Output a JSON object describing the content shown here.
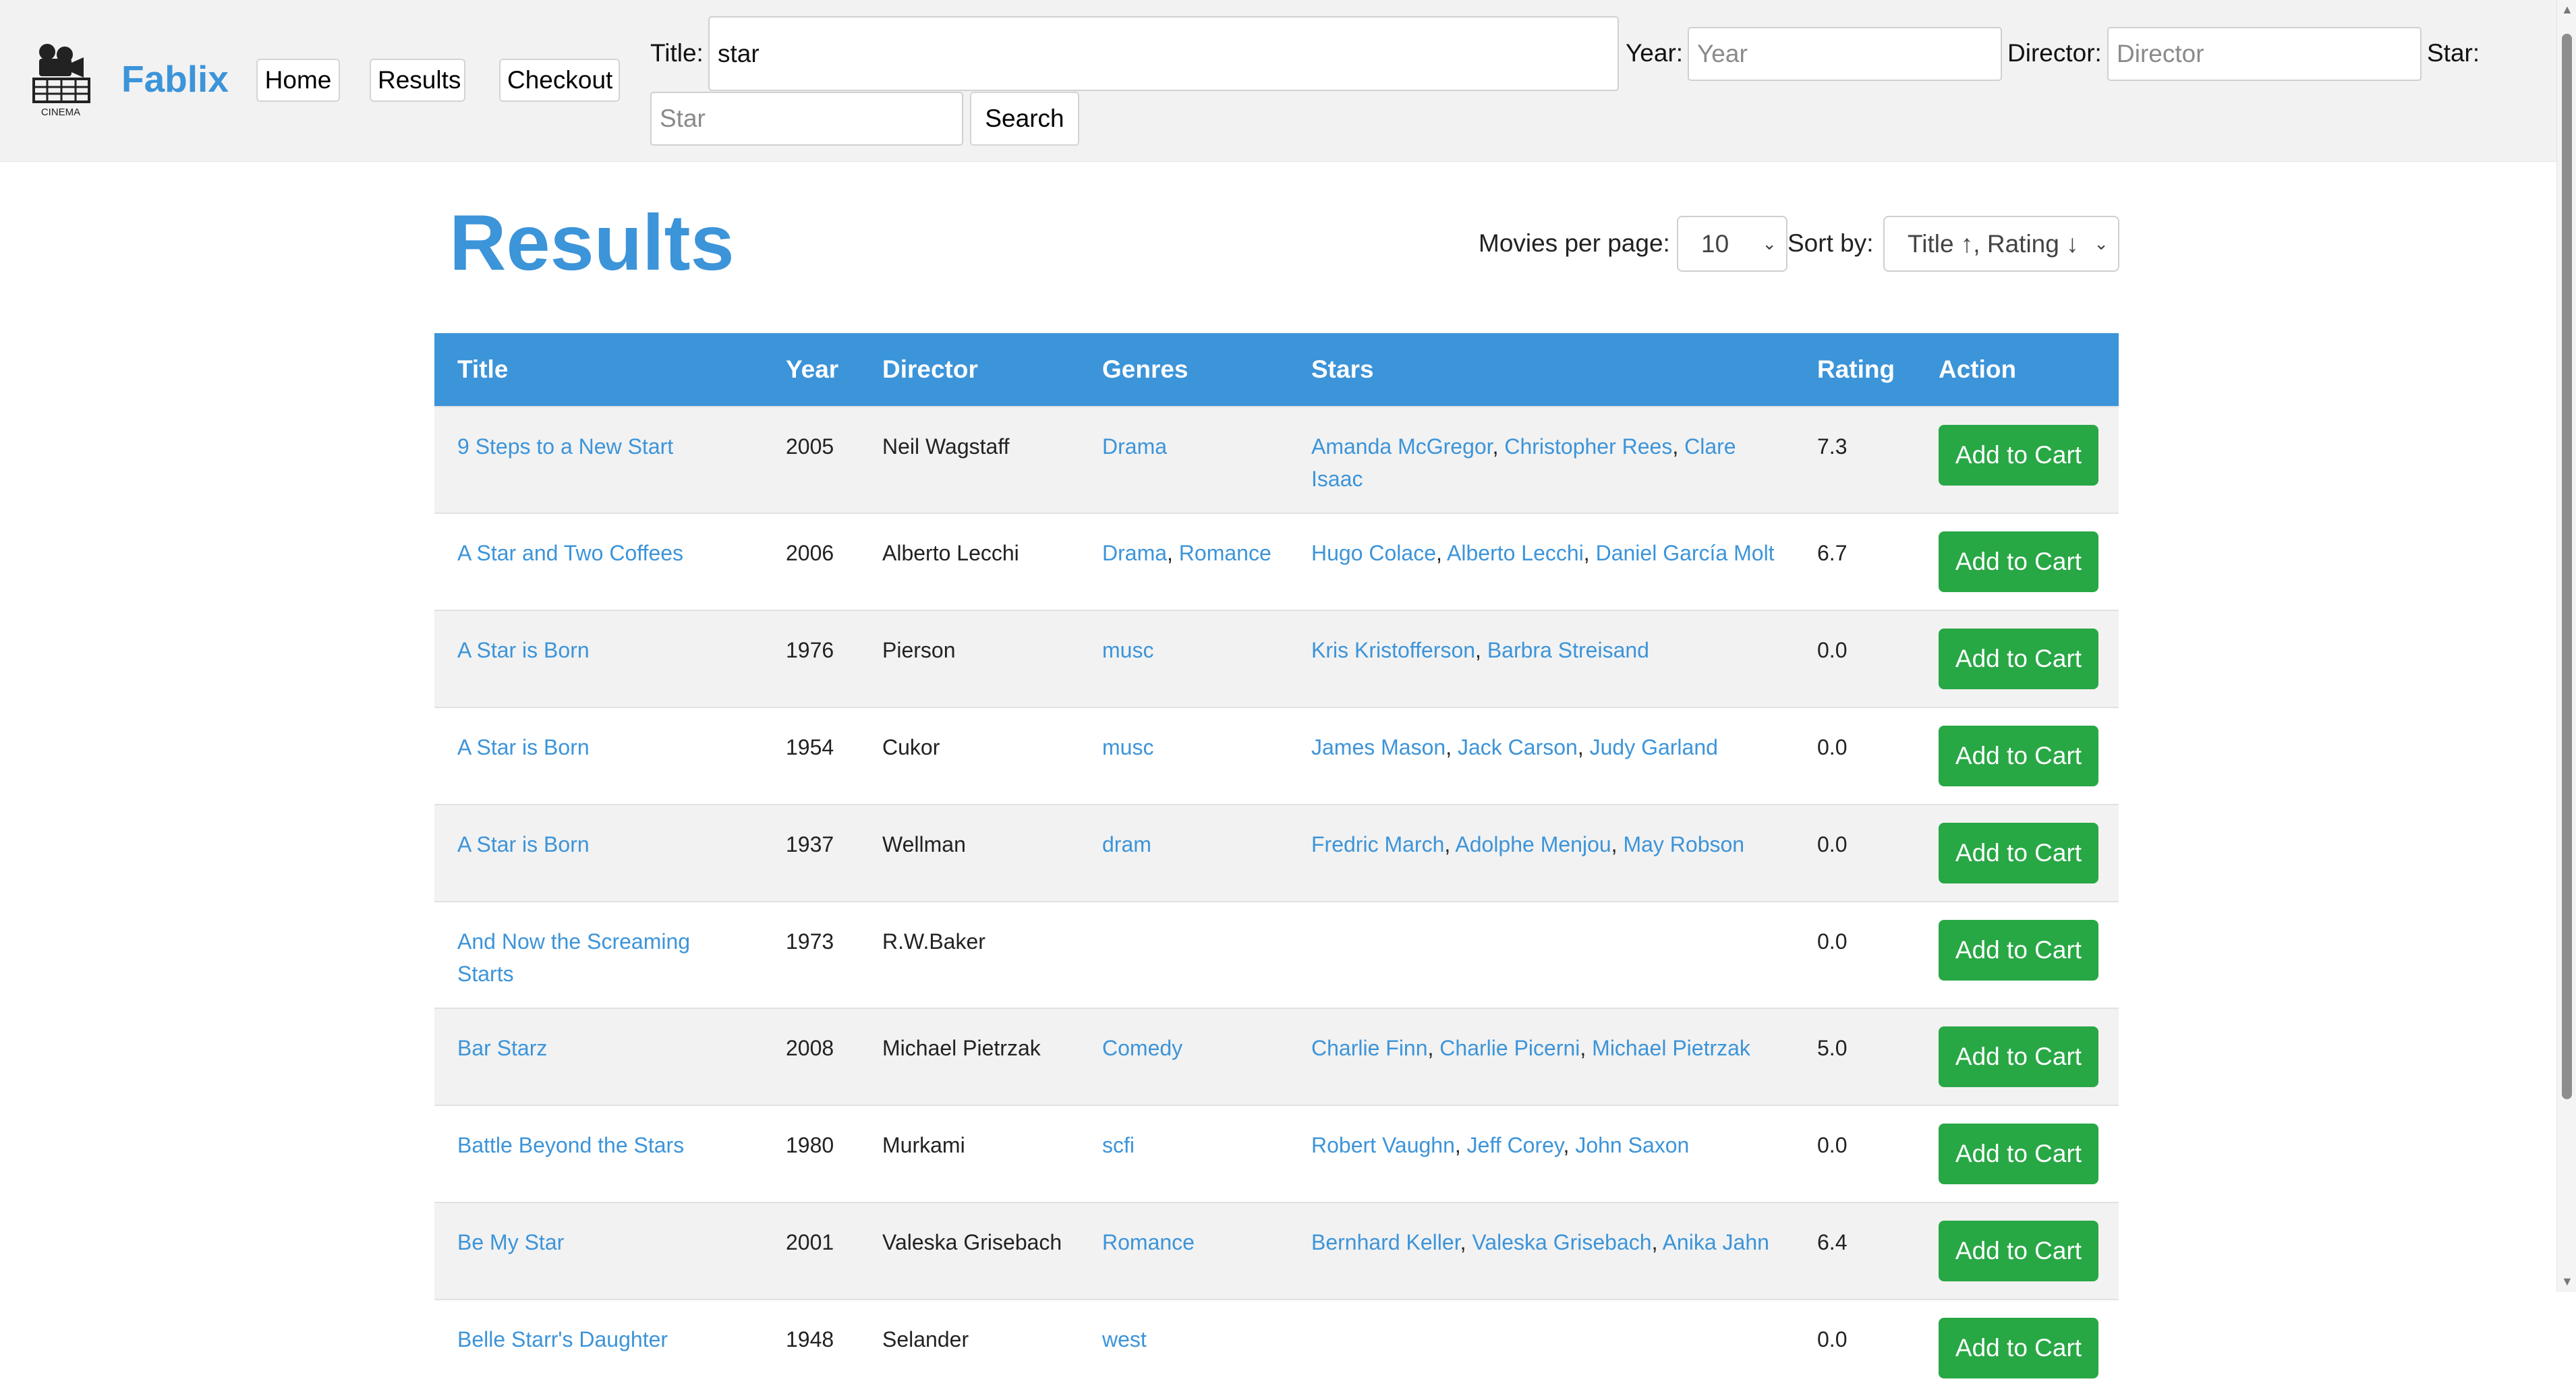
{
  "nav": {
    "brand": "Fablix",
    "logo_text": "CINEMA",
    "home": "Home",
    "results": "Results",
    "checkout": "Checkout"
  },
  "search": {
    "title_label": "Title:",
    "title_value": "star",
    "year_label": "Year:",
    "year_placeholder": "Year",
    "director_label": "Director:",
    "director_placeholder": "Director",
    "star_label": "Star:",
    "star_placeholder": "Star",
    "button": "Search"
  },
  "main": {
    "title": "Results",
    "per_page_label": "Movies per page:",
    "per_page_value": "10",
    "sort_label": "Sort by:",
    "sort_value": "Title ↑, Rating ↓"
  },
  "table": {
    "headers": [
      "Title",
      "Year",
      "Director",
      "Genres",
      "Stars",
      "Rating",
      "Action"
    ],
    "action_label": "Add to Cart",
    "rows": [
      {
        "title": "9 Steps to a New Start",
        "year": "2005",
        "director": "Neil Wagstaff",
        "genres": [
          "Drama"
        ],
        "stars": [
          "Amanda McGregor",
          "Christopher Rees",
          "Clare Isaac"
        ],
        "rating": "7.3"
      },
      {
        "title": "A Star and Two Coffees",
        "year": "2006",
        "director": "Alberto Lecchi",
        "genres": [
          "Drama",
          "Romance"
        ],
        "stars": [
          "Hugo Colace",
          "Alberto Lecchi",
          "Daniel García Molt"
        ],
        "rating": "6.7"
      },
      {
        "title": "A Star is Born",
        "year": "1976",
        "director": "Pierson",
        "genres": [
          "musc"
        ],
        "stars": [
          "Kris Kristofferson",
          "Barbra Streisand"
        ],
        "rating": "0.0"
      },
      {
        "title": "A Star is Born",
        "year": "1954",
        "director": "Cukor",
        "genres": [
          "musc"
        ],
        "stars": [
          "James Mason",
          "Jack Carson",
          "Judy Garland"
        ],
        "rating": "0.0"
      },
      {
        "title": "A Star is Born",
        "year": "1937",
        "director": "Wellman",
        "genres": [
          "dram"
        ],
        "stars": [
          "Fredric March",
          "Adolphe Menjou",
          "May Robson"
        ],
        "rating": "0.0"
      },
      {
        "title": "And Now the Screaming Starts",
        "year": "1973",
        "director": "R.W.Baker",
        "genres": [],
        "stars": [],
        "rating": "0.0"
      },
      {
        "title": "Bar Starz",
        "year": "2008",
        "director": "Michael Pietrzak",
        "genres": [
          "Comedy"
        ],
        "stars": [
          "Charlie Finn",
          "Charlie Picerni",
          "Michael Pietrzak"
        ],
        "rating": "5.0"
      },
      {
        "title": "Battle Beyond the Stars",
        "year": "1980",
        "director": "Murkami",
        "genres": [
          "scfi"
        ],
        "stars": [
          "Robert Vaughn",
          "Jeff Corey",
          "John Saxon"
        ],
        "rating": "0.0"
      },
      {
        "title": "Be My Star",
        "year": "2001",
        "director": "Valeska Grisebach",
        "genres": [
          "Romance"
        ],
        "stars": [
          "Bernhard Keller",
          "Valeska Grisebach",
          "Anika Jahn"
        ],
        "rating": "6.4"
      },
      {
        "title": "Belle Starr's Daughter",
        "year": "1948",
        "director": "Selander",
        "genres": [
          "west"
        ],
        "stars": [],
        "rating": "0.0"
      }
    ]
  }
}
